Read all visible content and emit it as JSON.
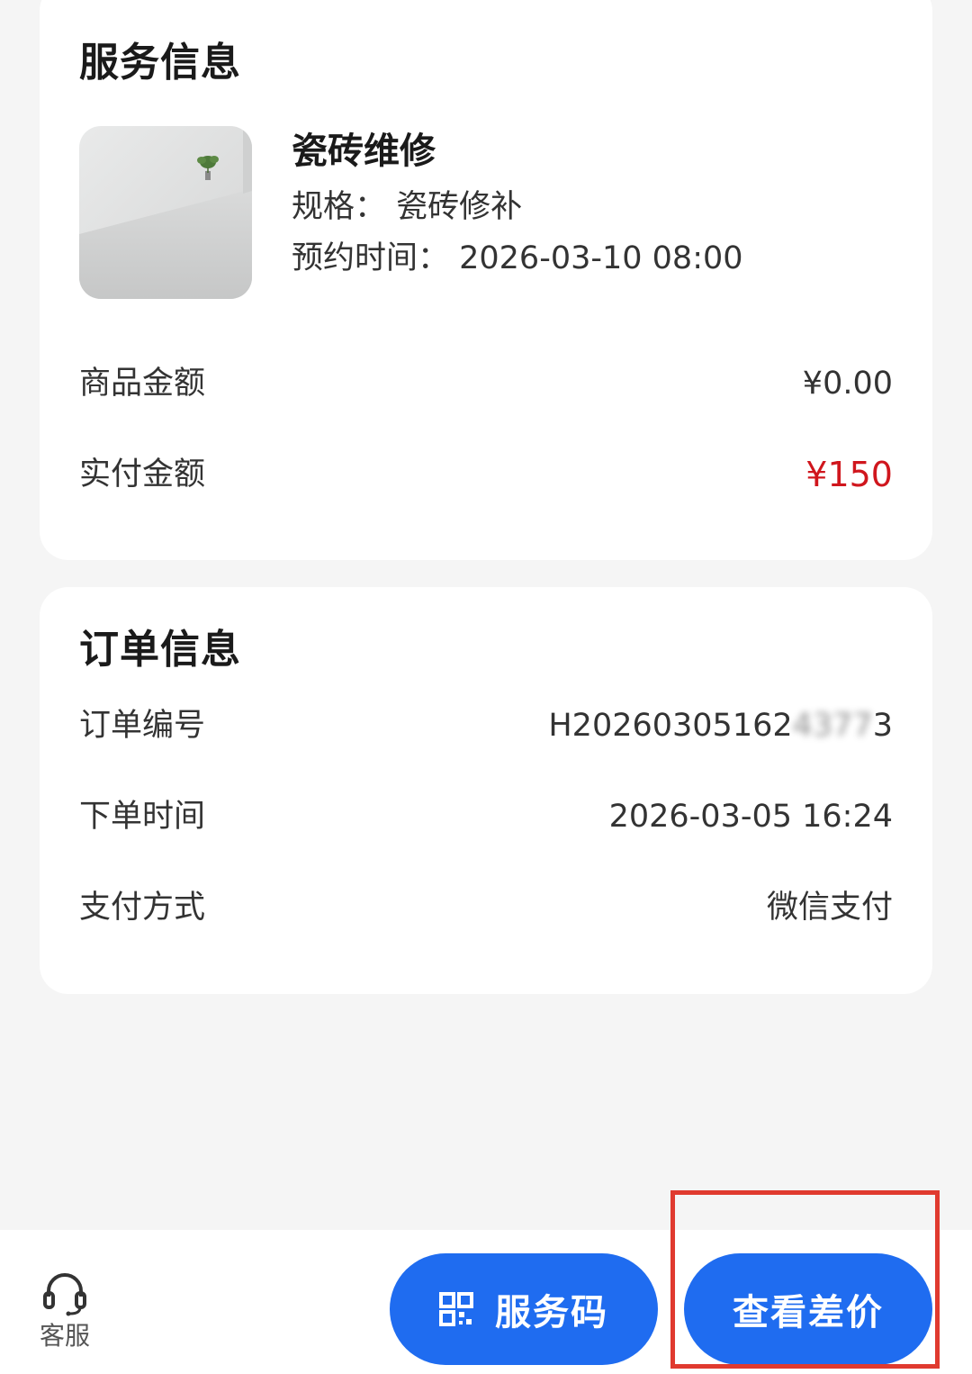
{
  "service": {
    "title": "服务信息",
    "name": "瓷砖维修",
    "spec_text": "规格：   瓷砖修补",
    "appointment_text": "预约时间：  2026-03-10 08:00",
    "goods_amount_label": "商品金额",
    "goods_amount_value": "¥0.00",
    "paid_amount_label": "实付金额",
    "paid_amount_value": "¥150"
  },
  "order": {
    "title": "订单信息",
    "number_label": "订单编号",
    "number_value_visible": "H20260305162",
    "number_value_obscured": "4377",
    "number_value_tail": "3",
    "time_label": "下单时间",
    "time_value": "2026-03-05 16:24",
    "pay_method_label": "支付方式",
    "pay_method_value": "微信支付"
  },
  "bottom_bar": {
    "customer_service_label": "客服",
    "customer_service_icon": "headset-icon",
    "service_code_label": "服务码",
    "service_code_icon": "qr-code-icon",
    "view_diff_label": "查看差价"
  },
  "colors": {
    "accent": "#1f6cf0",
    "price_red": "#d0161d",
    "highlight": "#e03a2f"
  }
}
